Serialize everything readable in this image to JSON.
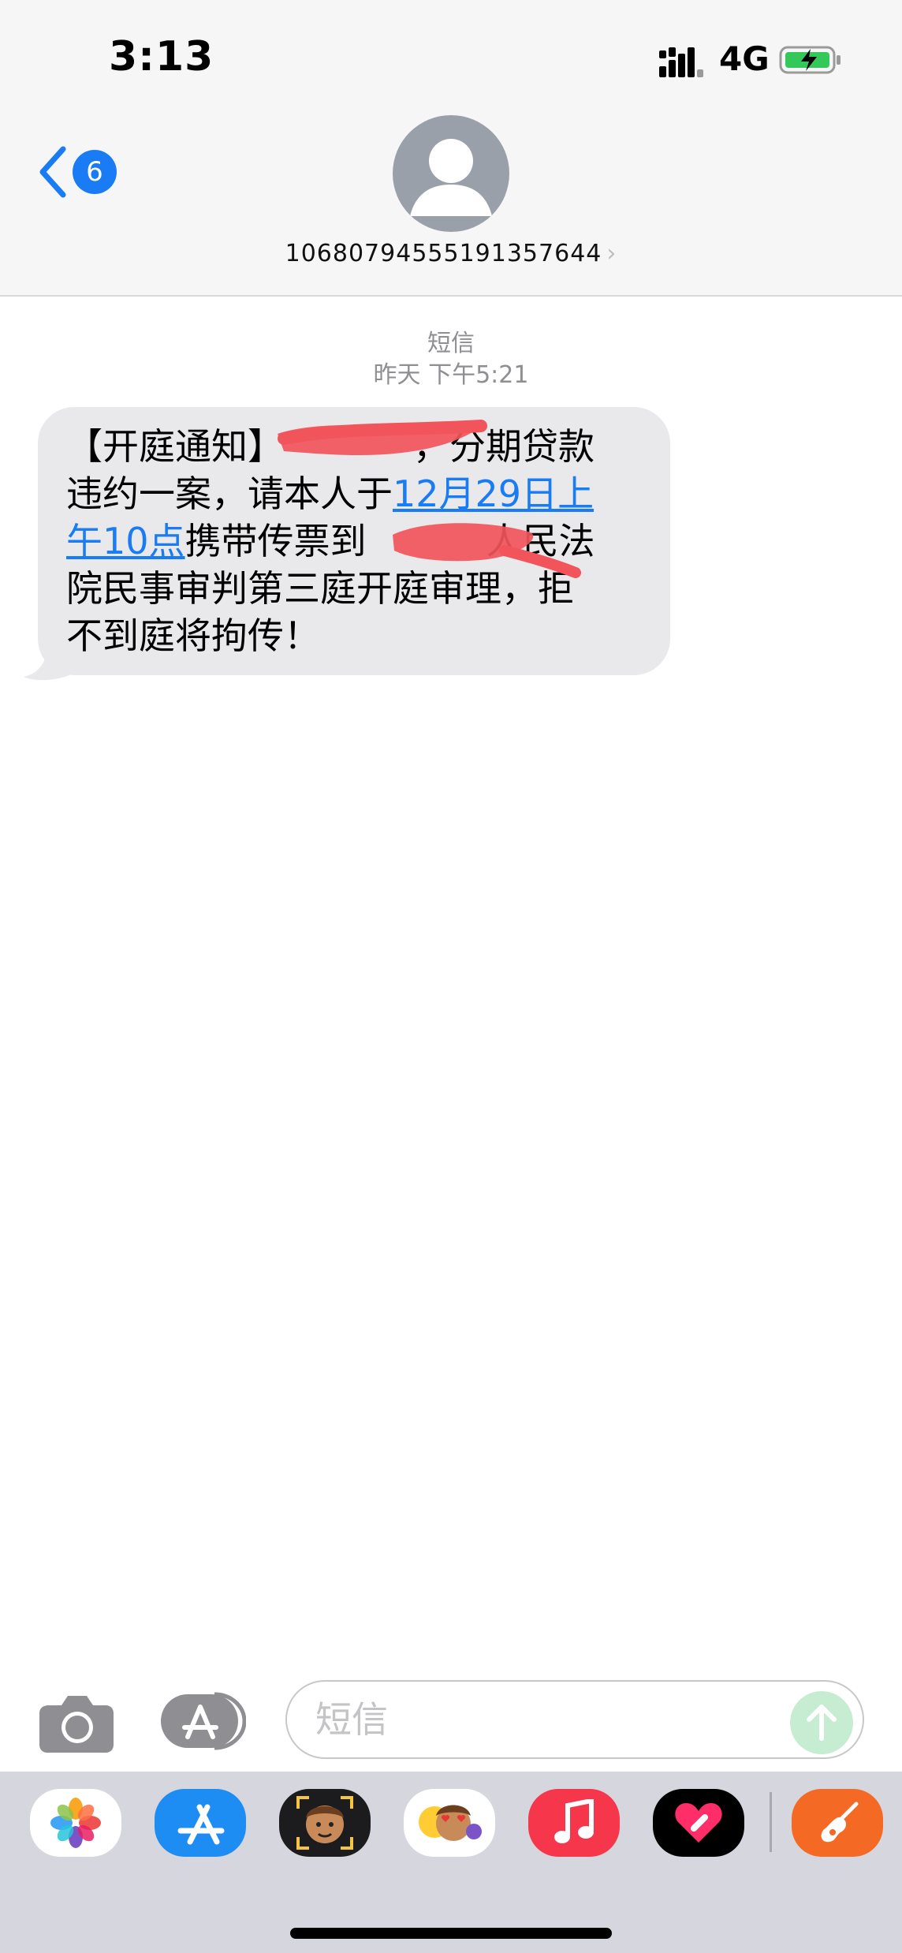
{
  "status_bar": {
    "time": "3:13",
    "network": "4G"
  },
  "header": {
    "back_count": "6",
    "contact_number": "10680794555191357644",
    "chevron": "›"
  },
  "thread": {
    "service_label": "短信",
    "timestamp": "昨天 下午5:21",
    "message": {
      "line1": "【开庭通知】",
      "line1b": "，分期贷款",
      "line2a": "违约一案，请本人于",
      "link1": "12月29日上",
      "link2": "午10点",
      "line3": "携带传票到",
      "line3b": "人民法",
      "line4": "院民事审判第三庭开庭审理，拒",
      "line5": "不到庭将拘传！"
    }
  },
  "composer": {
    "placeholder": "短信"
  },
  "colors": {
    "accent": "#1a7cf4",
    "bubble": "#e9e9eb",
    "redaction": "#f2545b",
    "send_disabled": "#c6ecd1"
  },
  "dock_apps": [
    "photos-icon",
    "app-store-icon",
    "memoji-camera-icon",
    "memoji-stickers-icon",
    "music-icon",
    "digital-touch-icon",
    "garageband-icon"
  ]
}
